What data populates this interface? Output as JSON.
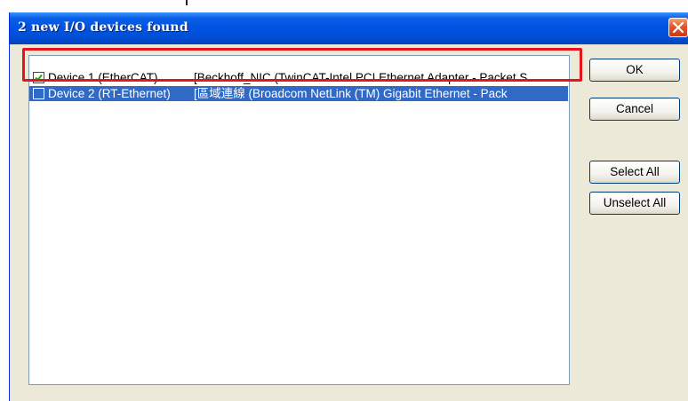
{
  "dialog": {
    "title": "2 new I/O devices found"
  },
  "devices": [
    {
      "name": "Device 1 (EtherCAT)",
      "description": "[Beckhoff_NIC (TwinCAT-Intel PCI Ethernet Adapter - Packet S",
      "checked": true,
      "selected": false
    },
    {
      "name": "Device 2 (RT-Ethernet)",
      "description": "[區域連線 (Broadcom NetLink (TM) Gigabit Ethernet - Pack",
      "checked": false,
      "selected": true
    }
  ],
  "buttons": {
    "ok": "OK",
    "cancel": "Cancel",
    "select_all": "Select All",
    "unselect_all": "Unselect All"
  },
  "colors": {
    "titlebar": "#0054e3",
    "selection": "#316ac5",
    "annotation_box": "#e8141c",
    "window_face": "#ece9d8",
    "checkmark": "#21a121"
  },
  "icons": {
    "close": "close-x-icon",
    "check": "checkmark-icon"
  }
}
